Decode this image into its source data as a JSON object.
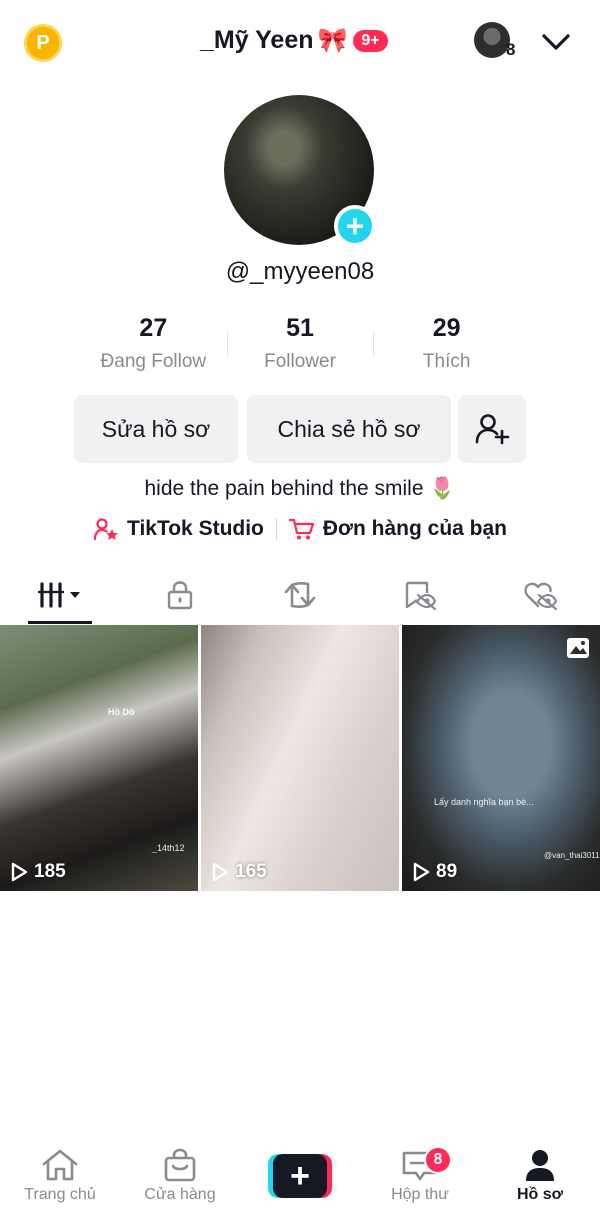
{
  "header": {
    "coin_label": "P",
    "title": "_Mỹ Yeen",
    "title_emoji": "🎀",
    "notif_badge": "9+",
    "account_count": "8"
  },
  "profile": {
    "handle": "@_myyeen08",
    "stats": [
      {
        "value": "27",
        "label": "Đang Follow"
      },
      {
        "value": "51",
        "label": "Follower"
      },
      {
        "value": "29",
        "label": "Thích"
      }
    ],
    "buttons": {
      "edit": "Sửa hồ sơ",
      "share": "Chia sẻ hồ sơ"
    },
    "bio": "hide the pain behind the smile 🌷",
    "links": [
      {
        "label": "TikTok Studio",
        "icon": "studio-icon"
      },
      {
        "label": "Đơn hàng của bạn",
        "icon": "cart-icon"
      }
    ]
  },
  "tabs": [
    {
      "name": "videos",
      "icon": "grid-icon",
      "active": true
    },
    {
      "name": "private",
      "icon": "lock-icon",
      "active": false
    },
    {
      "name": "reposts",
      "icon": "repost-icon",
      "active": false
    },
    {
      "name": "favorites",
      "icon": "bookmark-hidden-icon",
      "active": false
    },
    {
      "name": "liked",
      "icon": "heart-hidden-icon",
      "active": false
    }
  ],
  "videos": [
    {
      "views": "185",
      "caption": "Hồ Dò",
      "watermark": "_14th12",
      "is_photo": false
    },
    {
      "views": "165",
      "caption": "",
      "watermark": "",
      "is_photo": false
    },
    {
      "views": "89",
      "caption": "Lấy danh nghĩa bạn bè...",
      "watermark": "@van_thai3011",
      "is_photo": true
    }
  ],
  "bottom_nav": [
    {
      "label": "Trang chủ",
      "icon": "home-icon"
    },
    {
      "label": "Cửa hàng",
      "icon": "shop-icon"
    },
    {
      "label": "",
      "icon": "create-icon"
    },
    {
      "label": "Hộp thư",
      "icon": "inbox-icon",
      "badge": "8"
    },
    {
      "label": "Hồ sơ",
      "icon": "profile-icon",
      "active": true
    }
  ],
  "colors": {
    "accent_red": "#fe2c55",
    "accent_cyan": "#20d5ec",
    "text_primary": "#161823",
    "text_secondary": "#8a8b91",
    "button_bg": "#f1f1f2"
  }
}
